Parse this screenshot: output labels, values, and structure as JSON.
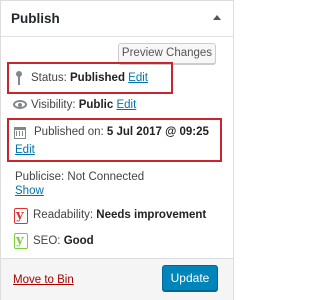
{
  "header": {
    "title": "Publish",
    "toggle_icon": "triangle-up-icon"
  },
  "actions": {
    "preview_label": "Preview Changes"
  },
  "status": {
    "label": "Status:",
    "value": "Published",
    "edit": "Edit"
  },
  "visibility": {
    "label": "Visibility:",
    "value": "Public",
    "edit": "Edit"
  },
  "published": {
    "label": "Published on:",
    "value": "5 Jul 2017 @ 09:25",
    "edit": "Edit"
  },
  "publicise": {
    "label": "Publicise: Not Connected",
    "show": "Show"
  },
  "readability": {
    "label": "Readability:",
    "value": "Needs improvement",
    "status_color": "#dc3232"
  },
  "seo": {
    "label": "SEO:",
    "value": "Good",
    "status_color": "#7ad03a"
  },
  "footer": {
    "trash_label": "Move to Bin",
    "update_label": "Update"
  },
  "colors": {
    "accent": "#0085ba",
    "link": "#0073aa",
    "highlight": "#c8252e",
    "trash": "#a00000"
  },
  "yoast_glyph": "y"
}
